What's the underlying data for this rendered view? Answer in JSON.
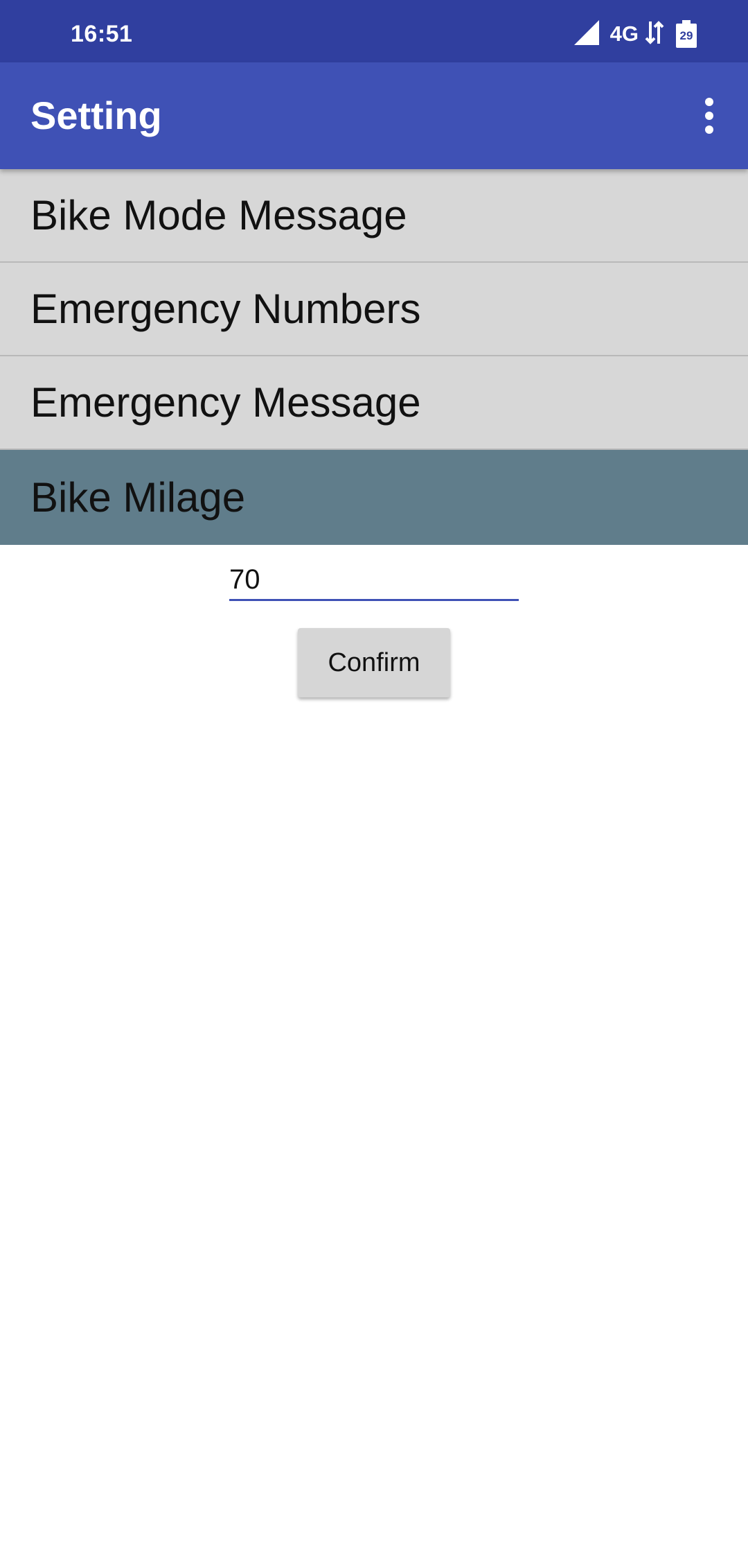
{
  "status_bar": {
    "time": "16:51",
    "network": "4G",
    "battery_level": "29",
    "icons": [
      "signal-icon",
      "data-transfer-icon",
      "battery-icon"
    ]
  },
  "app_bar": {
    "title": "Setting",
    "overflow_icon": "more-vert-icon"
  },
  "menu": {
    "items": [
      {
        "label": "Bike Mode Message"
      },
      {
        "label": "Emergency Numbers"
      },
      {
        "label": "Emergency Message"
      },
      {
        "label": "Bike Milage",
        "selected": true
      }
    ]
  },
  "milage_form": {
    "value": "70",
    "confirm_label": "Confirm"
  },
  "colors": {
    "status_bar": "#303f9f",
    "app_bar": "#3f51b5",
    "menu_item_bg": "#d7d7d7",
    "menu_item_selected_bg": "#607d8b",
    "input_underline": "#3f51b5",
    "button_bg": "#d6d6d6"
  }
}
